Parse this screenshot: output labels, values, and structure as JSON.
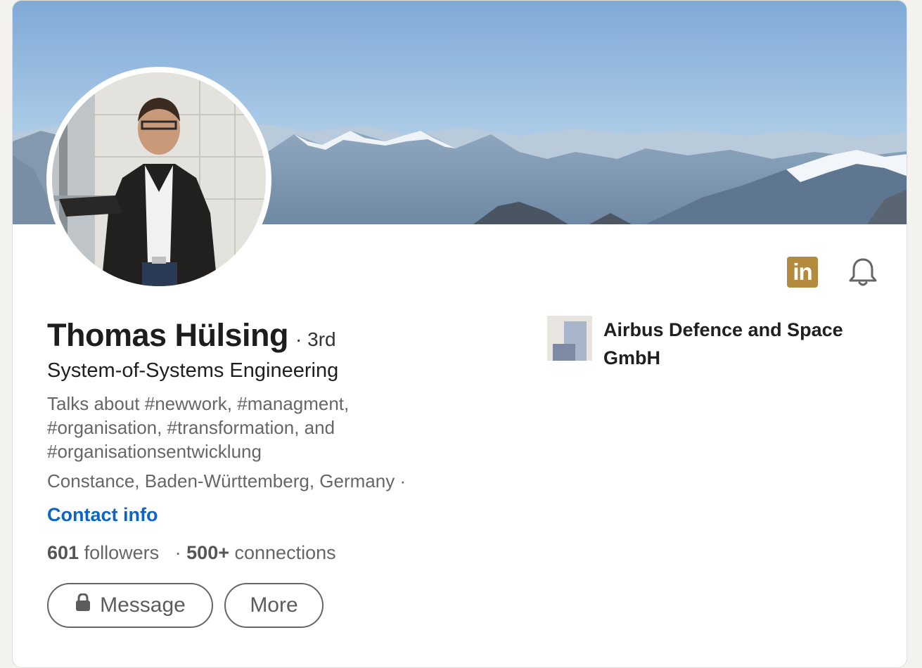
{
  "profile": {
    "name": "Thomas Hülsing",
    "degree": "· 3rd",
    "headline": "System-of-Systems Engineering",
    "talks_about": "Talks about #newwork, #managment, #organisation, #transformation, and #organisationsentwicklung",
    "location": "Constance, Baden-Württemberg, Germany ·",
    "contact_label": "Contact info",
    "followers_count": "601",
    "followers_label": "followers",
    "stats_separator": "·",
    "connections_count": "500+",
    "connections_label": "connections"
  },
  "company": {
    "name": "Airbus Defence and Space GmbH"
  },
  "actions": {
    "message_label": "Message",
    "more_label": "More"
  },
  "icons": {
    "premium": "linkedin-in-icon",
    "notify": "bell-icon",
    "message_lock": "lock-icon"
  },
  "colors": {
    "link": "#0a66c2",
    "linkedin_badge": "#b48a3e",
    "page_bg": "#f3f2ef"
  }
}
